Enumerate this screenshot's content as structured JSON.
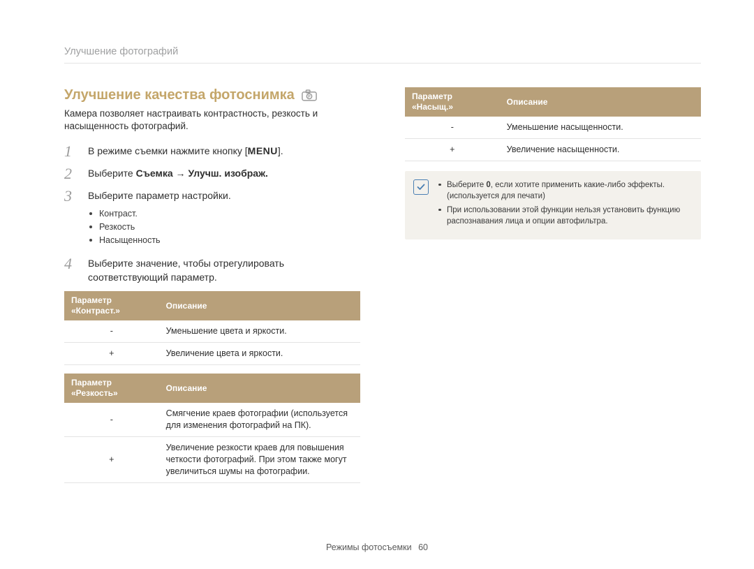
{
  "header": {
    "breadcrumb": "Улучшение фотографий"
  },
  "title": "Улучшение качества фотоснимка",
  "intro": "Камера позволяет настраивать контрастность, резкость и насыщенность фотографий.",
  "steps": {
    "s1_a": "В режиме съемки нажмите кнопку [",
    "s1_menu": "MENU",
    "s1_b": "].",
    "s2_a": "Выберите ",
    "s2_path": "Съемка → Улучш. изображ.",
    "s3": "Выберите параметр настройки.",
    "s3_items": [
      "Контраст.",
      "Резкость",
      "Насыщенность"
    ],
    "s4": "Выберите значение, чтобы отрегулировать соответствующий параметр."
  },
  "tables": {
    "contrast": {
      "head_param": "Параметр «Контраст.»",
      "head_desc": "Описание",
      "rows": [
        {
          "k": "-",
          "v": "Уменьшение цвета и яркости."
        },
        {
          "k": "+",
          "v": "Увеличение цвета и яркости."
        }
      ]
    },
    "sharpness": {
      "head_param": "Параметр «Резкость»",
      "head_desc": "Описание",
      "rows": [
        {
          "k": "-",
          "v": "Смягчение краев фотографии (используется для изменения фотографий на ПК)."
        },
        {
          "k": "+",
          "v": "Увеличение резкости краев для повышения четкости фотографий. При этом также могут увеличиться шумы на фотографии."
        }
      ]
    },
    "saturation": {
      "head_param": "Параметр «Насыщ.»",
      "head_desc": "Описание",
      "rows": [
        {
          "k": "-",
          "v": "Уменьшение насыщенности."
        },
        {
          "k": "+",
          "v": "Увеличение насыщенности."
        }
      ]
    }
  },
  "infobox": {
    "items": [
      {
        "pre": "Выберите ",
        "bold": "0",
        "post": ", если хотите применить какие-либо эффекты. (используется для печати)"
      },
      {
        "text": "При использовании этой функции нельзя установить функцию распознавания лица и опции автофильтра."
      }
    ]
  },
  "footer": {
    "section": "Режимы фотосъемки",
    "page": "60"
  }
}
